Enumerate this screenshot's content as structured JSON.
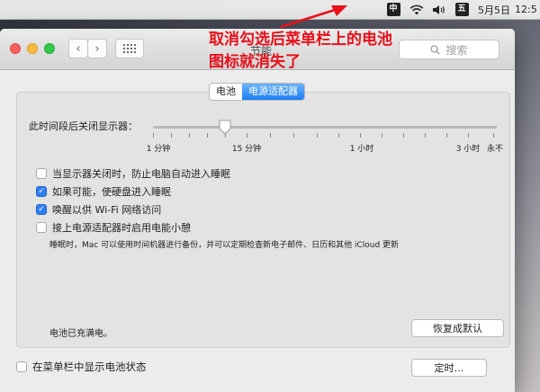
{
  "menubar": {
    "input_method": "中",
    "wubi": "五",
    "date": "5月5日",
    "time": "12:5"
  },
  "window": {
    "title": "节能",
    "search_placeholder": "搜索",
    "tabs": [
      {
        "label": "电池",
        "active": false
      },
      {
        "label": "电源适配器",
        "active": true
      }
    ],
    "display_off_label": "此时间段后关闭显示器：",
    "slider": {
      "ticks": [
        "1 分钟",
        "15 分钟",
        "1 小时",
        "3 小时",
        "永不"
      ],
      "value": "15 分钟"
    },
    "options": [
      {
        "label": "当显示器关闭时，防止电脑自动进入睡眠",
        "checked": false
      },
      {
        "label": "如果可能，使硬盘进入睡眠",
        "checked": true
      },
      {
        "label": "唤醒以供 Wi-Fi 网络访问",
        "checked": true
      },
      {
        "label": "接上电源适配器时启用电能小憩",
        "checked": false
      }
    ],
    "power_nap_note": "睡眠时，Mac 可以使用时间机器进行备份，并可以定期检查新电子邮件、日历和其他 iCloud 更新",
    "status_text": "电池已充满电。",
    "restore_button": "恢复成默认",
    "show_battery_label": "在菜单栏中显示电池状态",
    "show_battery_checked": false,
    "schedule_button": "定时…"
  },
  "annotation": {
    "text": "取消勾选后菜单栏上的电池图标就消失了",
    "color": "#e8101a"
  }
}
